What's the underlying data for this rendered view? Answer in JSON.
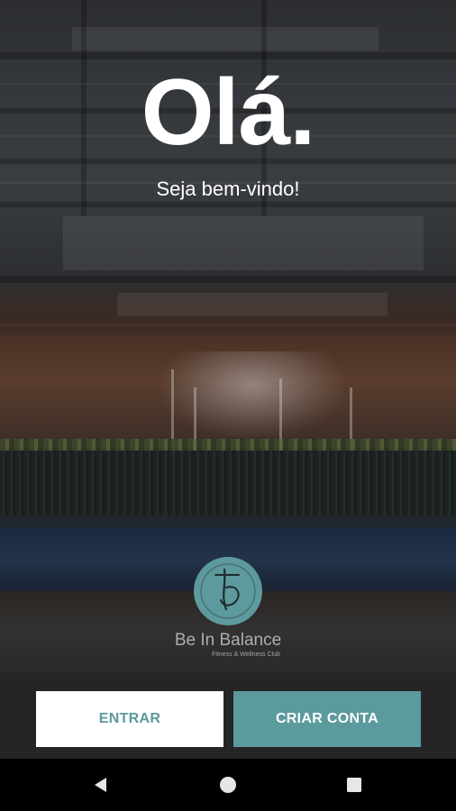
{
  "header": {
    "greeting": "Olá.",
    "welcome": "Seja bem-vindo!"
  },
  "brand": {
    "name": "Be In Balance",
    "tagline": "Fitness & Wellness Club",
    "logo_icon": "be-in-balance-logo",
    "accent_color": "#5b9a9d"
  },
  "actions": {
    "login_label": "ENTRAR",
    "signup_label": "CRIAR CONTA"
  },
  "navigation": {
    "back_icon": "back-triangle-icon",
    "home_icon": "home-circle-icon",
    "recent_icon": "recent-apps-square-icon"
  }
}
